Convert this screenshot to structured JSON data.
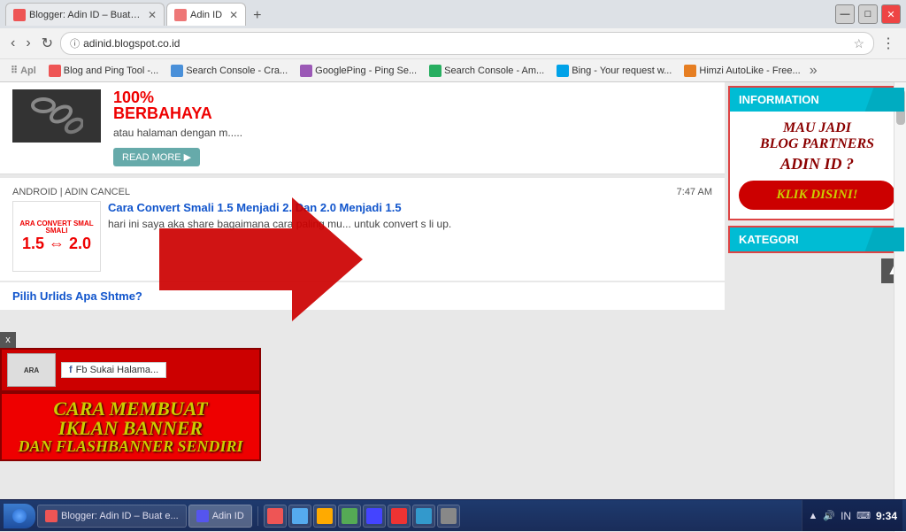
{
  "browser": {
    "tabs": [
      {
        "label": "Blogger: Adin ID – Buat e...",
        "favicon": "blogger",
        "active": false
      },
      {
        "label": "Adin ID",
        "favicon": "adin",
        "active": true
      }
    ],
    "url": "adinid.blogspot.co.id",
    "bookmarks": [
      {
        "label": "Apl",
        "icon": "apps"
      },
      {
        "label": "Blog and Ping Tool -...",
        "icon": "blogger"
      },
      {
        "label": "Search Console - Cra...",
        "icon": "search-console"
      },
      {
        "label": "GooglePing - Ping Se...",
        "icon": "googelping"
      },
      {
        "label": "Search Console - Am...",
        "icon": "search-console2"
      },
      {
        "label": "Bing - Your request w...",
        "icon": "bing"
      },
      {
        "label": "Himzi AutoLike - Free...",
        "icon": "himzi"
      }
    ]
  },
  "page": {
    "article_top": {
      "image_text1": "100%",
      "image_text2": "BERBAHAYA",
      "snippet": "atau halaman dengan m.....",
      "read_more": "READ MORE ▶"
    },
    "article_main": {
      "meta_left": "ANDROID | ADIN CANCEL",
      "meta_right": "7:47 AM",
      "smali_label1": "ARA CONVERT SMAL",
      "smali_label2": "SMALI",
      "smali_version": "1.5 ⇔ 2.0",
      "title": "Cara Convert Smali 1.5 Menjadi 2. Dan 2.0 Menjadi 1.5",
      "desc": "hari ini saya aka share bagaimana cara paling mu... untuk convert s li up."
    },
    "overlay": {
      "banner_text1": "CARA MEMBUAT",
      "banner_text2": "IKLAN BANNER",
      "banner_text3": "DAN FLASHBANNER SENDIRI",
      "fb_label": "Fb Sukai Halama..."
    },
    "tooltip": {
      "text": ""
    },
    "article_third": {
      "title": "Pilih Urlids Apa Shtme?"
    }
  },
  "sidebar": {
    "info_widget": {
      "header": "INFORMATION",
      "text1": "MAU JADI",
      "text2": "BLOG PARTNERS",
      "text3": "ADIN ID ?",
      "btn_label": "KLIK DISINI!"
    },
    "kategori_widget": {
      "header": "KATEGORI"
    }
  },
  "taskbar": {
    "buttons": [
      {
        "label": "Blogger: Adin ID – Buat e...",
        "icon": "blogger"
      },
      {
        "label": "Adin ID",
        "icon": "adin"
      }
    ],
    "tray": {
      "lang": "IN",
      "time": "9:34"
    }
  }
}
